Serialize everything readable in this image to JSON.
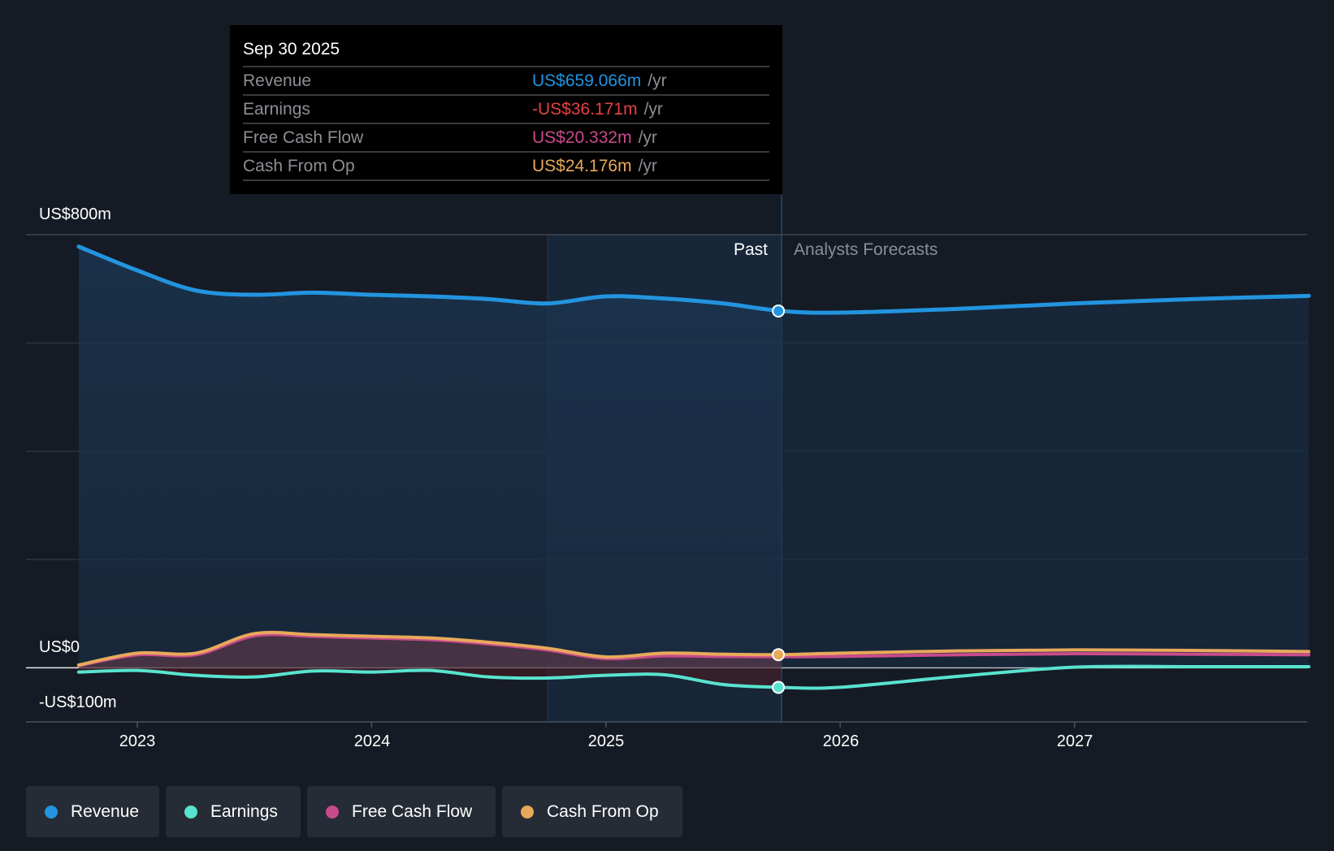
{
  "tooltip": {
    "date": "Sep 30 2025",
    "rows": [
      {
        "label": "Revenue",
        "value": "US$659.066m",
        "unit": "/yr",
        "color": "#2394df"
      },
      {
        "label": "Earnings",
        "value": "-US$36.171m",
        "unit": "/yr",
        "color": "#e64141"
      },
      {
        "label": "Free Cash Flow",
        "value": "US$20.332m",
        "unit": "/yr",
        "color": "#c84b8c"
      },
      {
        "label": "Cash From Op",
        "value": "US$24.176m",
        "unit": "/yr",
        "color": "#e8a95b"
      }
    ]
  },
  "regions": {
    "past": "Past",
    "forecast": "Analysts Forecasts"
  },
  "legend": [
    {
      "label": "Revenue",
      "color": "#2394df"
    },
    {
      "label": "Earnings",
      "color": "#58e3cf"
    },
    {
      "label": "Free Cash Flow",
      "color": "#c84b8c"
    },
    {
      "label": "Cash From Op",
      "color": "#e8a95b"
    }
  ],
  "chart_data": {
    "type": "line",
    "title": "",
    "xlabel": "",
    "ylabel": "",
    "ylim": [
      -100,
      800
    ],
    "xlim": [
      2022.55,
      2028.0
    ],
    "y_tick_labels": [
      "US$800m",
      "US$0",
      "-US$100m"
    ],
    "x_tick_labels": [
      "2023",
      "2024",
      "2025",
      "2026",
      "2027"
    ],
    "x_ticks": [
      2023,
      2024,
      2025,
      2026,
      2027
    ],
    "past_end": 2025.75,
    "highlight_start": 2024.75,
    "grid": true,
    "x": [
      2022.75,
      2023.0,
      2023.25,
      2023.5,
      2023.75,
      2024.0,
      2024.25,
      2024.5,
      2024.75,
      2025.0,
      2025.25,
      2025.5,
      2025.75,
      2026.0,
      2026.5,
      2027.0,
      2027.5,
      2028.0
    ],
    "series": [
      {
        "name": "Revenue",
        "color": "#2394df",
        "values": [
          778,
          734,
          697,
          689,
          693,
          689,
          686,
          681,
          673,
          686,
          682,
          673,
          659.066,
          656,
          663,
          673,
          681,
          687
        ]
      },
      {
        "name": "Earnings",
        "color": "#58e3cf",
        "values": [
          -8,
          -5,
          -14,
          -17,
          -6,
          -8,
          -5,
          -17,
          -19,
          -14,
          -13,
          -31,
          -36.171,
          -36,
          -16,
          1,
          2,
          2
        ]
      },
      {
        "name": "Free Cash Flow",
        "color": "#c84b8c",
        "values": [
          4,
          24,
          24,
          59,
          58,
          55,
          52,
          44,
          33,
          17,
          22,
          21,
          20.332,
          21,
          24,
          26,
          25,
          24
        ]
      },
      {
        "name": "Cash From Op",
        "color": "#e8a95b",
        "values": [
          5,
          27,
          27,
          63,
          61,
          58,
          55,
          47,
          36,
          20,
          27,
          25,
          24.176,
          27,
          31,
          33,
          32,
          30
        ]
      }
    ]
  }
}
